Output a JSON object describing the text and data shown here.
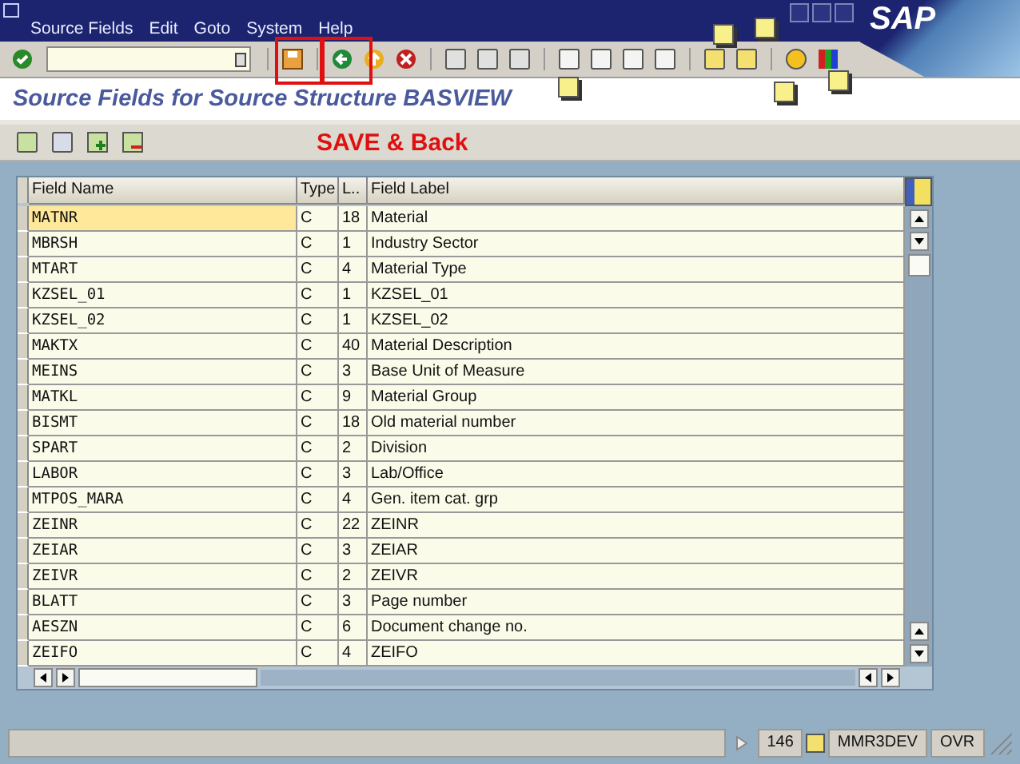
{
  "menu": [
    {
      "label": "Source Fields"
    },
    {
      "label": "Edit"
    },
    {
      "label": "Goto"
    },
    {
      "label": "System"
    },
    {
      "label": "Help"
    }
  ],
  "logo": "SAP",
  "page_title": "Source Fields for Source Structure BASVIEW",
  "annotation": "SAVE & Back",
  "table": {
    "columns": [
      "Field Name",
      "Type",
      "L..",
      "Field Label"
    ],
    "rows": [
      {
        "name": "MATNR",
        "type": "C",
        "length": "18",
        "label": "Material",
        "selected": true
      },
      {
        "name": "MBRSH",
        "type": "C",
        "length": "1",
        "label": "Industry Sector",
        "selected": false
      },
      {
        "name": "MTART",
        "type": "C",
        "length": "4",
        "label": "Material Type",
        "selected": false
      },
      {
        "name": "KZSEL_01",
        "type": "C",
        "length": "1",
        "label": "KZSEL_01",
        "selected": false
      },
      {
        "name": "KZSEL_02",
        "type": "C",
        "length": "1",
        "label": "KZSEL_02",
        "selected": false
      },
      {
        "name": "MAKTX",
        "type": "C",
        "length": "40",
        "label": "Material Description",
        "selected": false
      },
      {
        "name": "MEINS",
        "type": "C",
        "length": "3",
        "label": "Base Unit of Measure",
        "selected": false
      },
      {
        "name": "MATKL",
        "type": "C",
        "length": "9",
        "label": "Material Group",
        "selected": false
      },
      {
        "name": "BISMT",
        "type": "C",
        "length": "18",
        "label": "Old material number",
        "selected": false
      },
      {
        "name": "SPART",
        "type": "C",
        "length": "2",
        "label": "Division",
        "selected": false
      },
      {
        "name": "LABOR",
        "type": "C",
        "length": "3",
        "label": "Lab/Office",
        "selected": false
      },
      {
        "name": "MTPOS_MARA",
        "type": "C",
        "length": "4",
        "label": "Gen. item cat. grp",
        "selected": false
      },
      {
        "name": "ZEINR",
        "type": "C",
        "length": "22",
        "label": "ZEINR",
        "selected": false
      },
      {
        "name": "ZEIAR",
        "type": "C",
        "length": "3",
        "label": "ZEIAR",
        "selected": false
      },
      {
        "name": "ZEIVR",
        "type": "C",
        "length": "2",
        "label": "ZEIVR",
        "selected": false
      },
      {
        "name": "BLATT",
        "type": "C",
        "length": "3",
        "label": "Page number",
        "selected": false
      },
      {
        "name": "AESZN",
        "type": "C",
        "length": "6",
        "label": "Document change no.",
        "selected": false
      },
      {
        "name": "ZEIFO",
        "type": "C",
        "length": "4",
        "label": "ZEIFO",
        "selected": false
      }
    ]
  },
  "status_bar": {
    "session": "146",
    "system": "MMR3DEV",
    "mode": "OVR"
  }
}
